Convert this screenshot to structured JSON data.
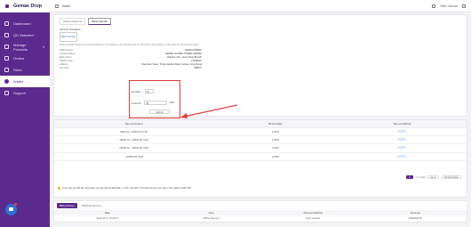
{
  "sidebar": {
    "logo_text": "Gemae Drop",
    "items": [
      {
        "label": "Dashboard",
        "icon": "dashboard-icon"
      },
      {
        "label": "QD Selected",
        "icon": "star-icon"
      },
      {
        "label": "Manage Products",
        "icon": "box-icon",
        "caret": "▾"
      },
      {
        "label": "Orders",
        "icon": "orders-icon"
      },
      {
        "label": "Store",
        "icon": "store-icon"
      },
      {
        "label": "Wallet",
        "icon": "wallet-icon",
        "active": true
      },
      {
        "label": "Support",
        "icon": "support-icon"
      }
    ],
    "chat_icon": "chat-icon"
  },
  "topbar": {
    "breadcrumb": "Wallet",
    "user": "Hello Gemae"
  },
  "payment": {
    "tabs": [
      "Online Payment",
      "Bank transfer"
    ],
    "active_tab": 1,
    "bank_label": "Service Providers",
    "bank_logo_text": "Bank Transfer",
    "note": "Please double check your amount aligned to the details by the transfer and we will confirm the delivery of the order by your account after.",
    "details": [
      {
        "k": "USD Account",
        "v": "0961017438016"
      },
      {
        "k": "Account Name",
        "v": "GEMAE GLOBAL KOREA LIMITED"
      },
      {
        "k": "Bank Name",
        "v": "Citibank, N.A., Hong Kong Branch"
      },
      {
        "k": "SWIFT Code",
        "v": "CITIHKHX"
      },
      {
        "k": "Address",
        "v": "Champion Tower, Three Garden Road, Central, Hong Kong"
      },
      {
        "k": "Zip Code",
        "v": "999077"
      }
    ],
    "form": {
      "number_label": "Number",
      "number_value": "10",
      "amount_label": "Amount",
      "amount_value": "50",
      "unit": "USD",
      "submit_label": "Submit"
    }
  },
  "bonus": {
    "headers": [
      "Top-up Amount",
      "Bonus Rate",
      "Top-up Method"
    ],
    "rows": [
      {
        "amount": "5000.01 - 10000.00 USD",
        "rate": "1.00%"
      },
      {
        "amount": "10000.01 - 20000.00 USD",
        "rate": "1.50%"
      },
      {
        "amount": "20000.01 - 30000.00 USD",
        "rate": "2.00%"
      },
      {
        "amount": "> 30000.00 USD",
        "rate": "2.50%"
      }
    ],
    "pagination": {
      "page": "1",
      "page_label": "1 / 1 total",
      "goto": "Go to",
      "per_page": "10 items/page"
    },
    "note": "If you top-up 300.00, otherwise you get will be $30,000 + 1.0% = $1,000. The total amount you get in the wallet is $31,000"
  },
  "billing": {
    "tabs": [
      "Billing History",
      "Withdraw Record"
    ],
    "headers": [
      "Date",
      "Type",
      "Payment Method",
      "Amounts"
    ],
    "rows": [
      {
        "date": "2022-10-17 16:18:04",
        "type": "Offline Payment",
        "method": "bank_transfer",
        "amount": "20000000.00"
      }
    ]
  }
}
